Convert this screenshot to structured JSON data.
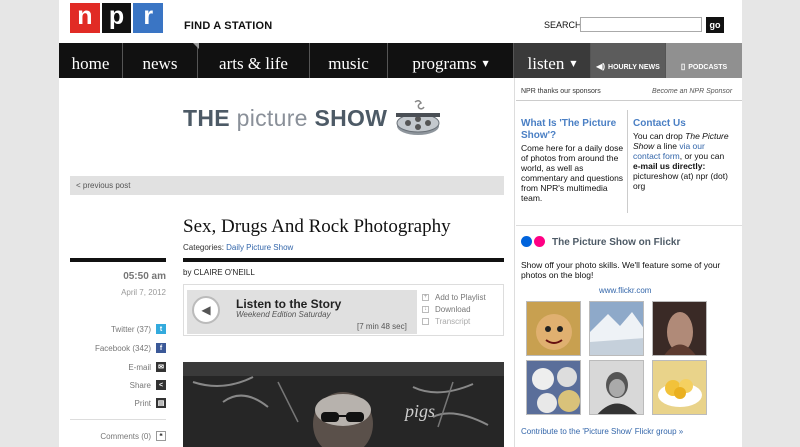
{
  "header": {
    "logo_letters": [
      "n",
      "p",
      "r"
    ],
    "find_station": "FIND A STATION",
    "search_label": "SEARCH",
    "search_placeholder": "",
    "go_label": "go"
  },
  "nav": {
    "items": [
      "home",
      "news",
      "arts & life",
      "music",
      "programs"
    ],
    "listen": "listen",
    "hourly_news": "HOURLY NEWS",
    "podcasts": "PODCASTS"
  },
  "banner": {
    "the": "THE",
    "picture": "picture",
    "show": "SHOW"
  },
  "article": {
    "previous_post": "< previous post",
    "time": "05:50 am",
    "date": "April 7, 2012",
    "share": [
      {
        "label": "Twitter (37)",
        "icon": "twitter-icon"
      },
      {
        "label": "Facebook (342)",
        "icon": "facebook-icon"
      },
      {
        "label": "E-mail",
        "icon": "email-icon"
      },
      {
        "label": "Share",
        "icon": "share-icon"
      },
      {
        "label": "Print",
        "icon": "print-icon"
      }
    ],
    "comments": "Comments (0)",
    "headline": "Sex, Drugs And Rock Photography",
    "categories_label": "Categories:",
    "category": "Daily Picture Show",
    "byline": "by CLAIRE O'NEILL",
    "listen_title": "Listen to the Story",
    "program": "Weekend Edition Saturday",
    "duration": "[7 min 48 sec]",
    "actions": [
      "Add to Playlist",
      "Download",
      "Transcript"
    ]
  },
  "sidebar": {
    "sponsor_thanks": "NPR thanks our sponsors",
    "become_sponsor": "Become an NPR Sponsor",
    "what_heading": "What Is 'The Picture Show'?",
    "what_text": "Come here for a daily dose of photos from around the world, as well as commentary and questions from NPR's multimedia team.",
    "contact_heading": "Contact Us",
    "contact_pre": "You can drop ",
    "contact_italic": "The Picture Show",
    "contact_mid": " a line ",
    "contact_link": "via our contact form",
    "contact_post": ", or you can ",
    "contact_bold": "e-mail us directly:",
    "contact_email": " pictureshow (at) npr (dot) org",
    "flickr_title": "The Picture Show on Flickr",
    "flickr_desc": "Show off your photo skills. We'll feature some of your photos on the blog!",
    "flickr_link": "www.flickr.com",
    "contribute": "Contribute to the 'Picture Show' Flickr group »"
  },
  "colors": {
    "npr_red": "#e12b25",
    "npr_blue": "#3a75c4",
    "link_blue": "#3366aa",
    "flickr_blue": "#0063dc",
    "flickr_pink": "#ff0084"
  }
}
